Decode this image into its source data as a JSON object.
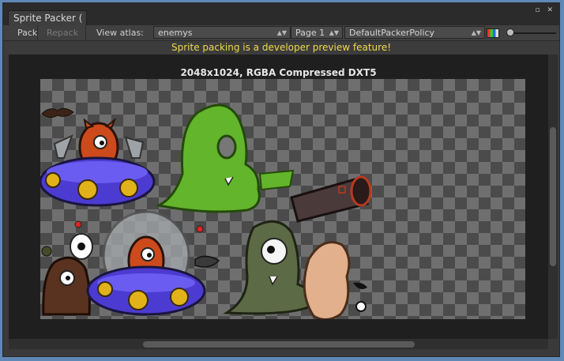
{
  "window": {
    "tab_title": "Sprite Packer (",
    "icons": [
      "maximize-icon",
      "close-icon",
      "menu-icon"
    ]
  },
  "toolbar": {
    "pack_label": "Pack",
    "repack_label": "Repack",
    "view_atlas_label": "View atlas:",
    "atlas_value": "enemys",
    "page_value": "Page 1",
    "policy_value": "DefaultPackerPolicy"
  },
  "notice": {
    "text": "Sprite packing is a developer preview feature!",
    "color": "#f0d84a"
  },
  "atlas": {
    "info": "2048x1024, RGBA Compressed DXT5"
  },
  "colors": {
    "background": "#5f88b6",
    "panel": "#3a3a3a",
    "checker_dark": "#4b4b4b",
    "checker_light": "#6f6f6f"
  }
}
